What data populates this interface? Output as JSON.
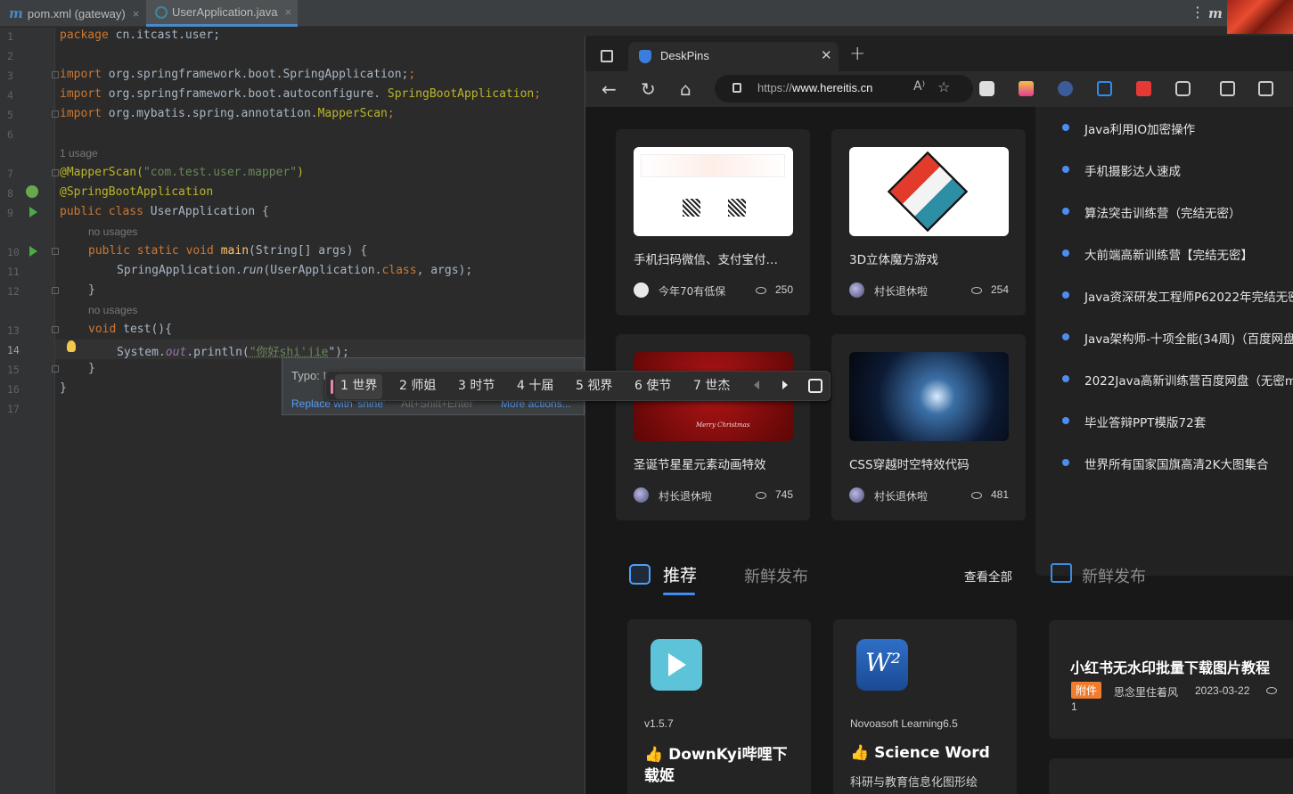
{
  "ide": {
    "tabs": [
      {
        "label": "pom.xml (gateway)",
        "icon": "maven-icon"
      },
      {
        "label": "UserApplication.java",
        "icon": "java-class-icon"
      }
    ],
    "tab_close": "×",
    "menu_dots": "⋮",
    "right_icon": "m",
    "line_numbers": [
      "1",
      "2",
      "3",
      "4",
      "5",
      "6",
      "7",
      "8",
      "9",
      "10",
      "11",
      "12",
      "13",
      "14",
      "15",
      "16",
      "17"
    ],
    "code": {
      "l1_kw": "package",
      "l1_rest": " cn.itcast.user;",
      "l3_kw": "import",
      "l3_rest": " org.springframework.boot.SpringApplication;",
      "l4_kw": "import",
      "l4_rest": " org.springframework.boot.autoconfigure.",
      "l4_ann": " SpringBootApplication",
      "l4_end": ";",
      "l5_kw": "import",
      "l5_rest": " org.mybatis.spring.annotation.",
      "l5_ann": "MapperScan",
      "l5_end": ";",
      "hint_usage": "1 usage",
      "l7_ann": "@MapperScan(",
      "l7_str": "\"com.test.user.mapper\"",
      "l7_end": ")",
      "l8_ann": "@SpringBootApplication",
      "l9_kw": "public class",
      "l9_rest": " UserApplication {",
      "hint_no_usages_1": "no usages",
      "l10_kw": "public static void",
      "l10_fn": " main",
      "l10_rest": "(String[] args) {",
      "l11_a": "SpringApplication.",
      "l11_run": "run",
      "l11_b": "(UserApplication.",
      "l11_class": "class",
      "l11_c": ", args);",
      "l12": "}",
      "hint_no_usages_2": "no usages",
      "l13_kw": "void",
      "l13_rest": " test(){",
      "l14_a": "System.",
      "l14_out": "out",
      "l14_b": ".println(",
      "l14_str": "\"你好shi'jie",
      "l14_c": "\");",
      "l15": "}",
      "l16": "}"
    },
    "typo_popup": {
      "label": "Typo: I",
      "replace": "Replace with 'shine'",
      "shortcut": "Alt+Shift+Enter",
      "more": "More actions..."
    }
  },
  "ime": {
    "candidates": [
      "1 世界",
      "2 师姐",
      "3 时节",
      "4 十届",
      "5 视界",
      "6 使节",
      "7 世杰"
    ]
  },
  "browser": {
    "tab_title": "DeskPins",
    "tab_close": "✕",
    "new_tab": "+",
    "url_scheme": "https://",
    "url_host": "www.hereitis.cn",
    "read_aloud": "A⁾",
    "favorite": "☆",
    "back": "←",
    "reload": "↻",
    "home": "⌂",
    "extension_icons": [
      "ghost-extension-icon",
      "download-extension-icon",
      "cursor-extension-icon",
      "crop-extension-icon",
      "fe-extension-icon",
      "puzzle-extensions-icon",
      "split-screen-icon",
      "collections-icon"
    ],
    "cards": [
      {
        "title": "手机扫码微信、支付宝付…",
        "author": "今年70有低保",
        "views": "250"
      },
      {
        "title": "3D立体魔方游戏",
        "author": "村长退休啦",
        "views": "254"
      },
      {
        "title": "圣诞节星星元素动画特效",
        "author": "村长退休啦",
        "views": "745"
      },
      {
        "title": "CSS穿越时空特效代码",
        "author": "村长退休啦",
        "views": "481"
      }
    ],
    "card_image_text": "Merry Christmas",
    "side_list": [
      "Java利用IO加密操作",
      "手机摄影达人速成",
      "算法突击训练营（完结无密）",
      "大前端高新训练营【完结无密】",
      "Java资深研发工程师P62022年完结无密",
      "Java架构师-十项全能(34周)（百度网盘",
      "2022Java高新训练营百度网盘（无密m",
      "毕业答辩PPT模版72套",
      "世界所有国家国旗高清2K大图集合"
    ],
    "section": {
      "recommend": "推荐",
      "fresh": "新鲜发布",
      "view_all": "查看全部",
      "fresh_2": "新鲜发布"
    },
    "software": [
      {
        "version": "v1.5.7",
        "name": "👍 DownKyi哔哩下载姬",
        "desc": ""
      },
      {
        "version": "Novoasoft Learning6.5",
        "name": "👍 Science Word",
        "desc": "科研与教育信息化图形绘"
      }
    ],
    "article": {
      "title": "小红书无水印批量下载图片教程",
      "badge": "附件",
      "author": "思念里住着风",
      "date": "2023-03-22",
      "views": "1"
    }
  }
}
